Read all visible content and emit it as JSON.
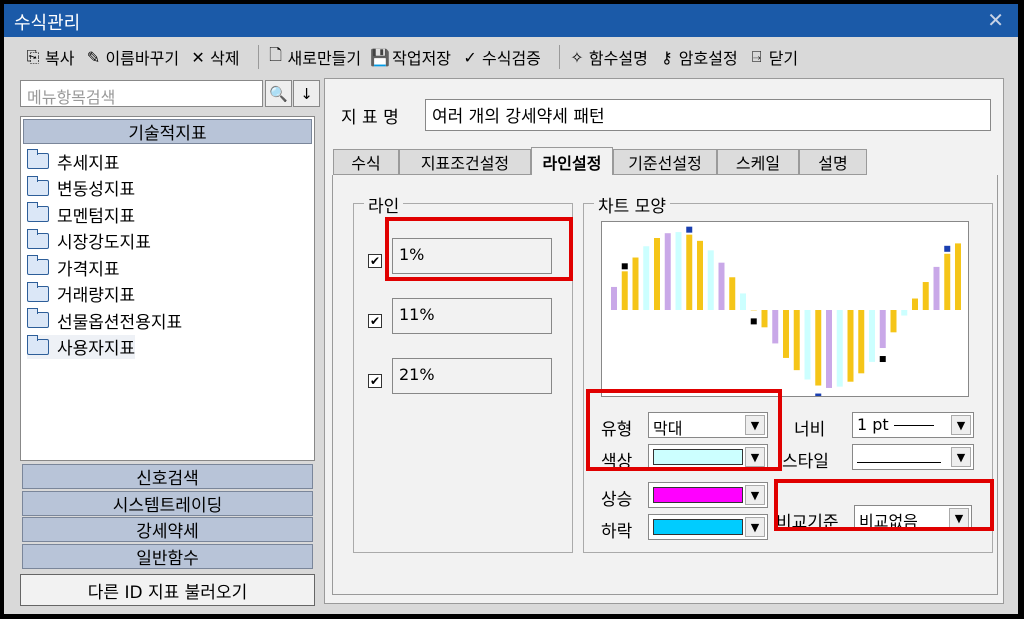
{
  "window": {
    "title": "수식관리",
    "close": "✕"
  },
  "toolbar": [
    {
      "icon": "copy-icon",
      "glyph": "⎘",
      "label": "복사"
    },
    {
      "icon": "rename-icon",
      "glyph": "✎",
      "label": "이름바꾸기"
    },
    {
      "icon": "delete-icon",
      "glyph": "✕",
      "label": "삭제"
    },
    {
      "icon": "new-icon",
      "glyph": "🗋",
      "label": "새로만들기"
    },
    {
      "icon": "save-icon",
      "glyph": "💾",
      "label": "작업저장"
    },
    {
      "icon": "verify-icon",
      "glyph": "✓",
      "label": "수식검증"
    },
    {
      "icon": "function-help-icon",
      "glyph": "✧",
      "label": "함수설명"
    },
    {
      "icon": "key-icon",
      "glyph": "⚷",
      "label": "암호설정"
    },
    {
      "icon": "exit-icon",
      "glyph": "⍈",
      "label": "닫기"
    }
  ],
  "left": {
    "search_placeholder": "메뉴항목검색",
    "search_icon": "🔍",
    "down_icon": "↓",
    "header": "기술적지표",
    "tree": [
      "추세지표",
      "변동성지표",
      "모멘텀지표",
      "시장강도지표",
      "가격지표",
      "거래량지표",
      "선물옵션전용지표",
      "사용자지표"
    ],
    "sections": [
      "신호검색",
      "시스템트레이딩",
      "강세약세",
      "일반함수"
    ],
    "load_button": "다른 ID 지표 불러오기"
  },
  "right": {
    "name_label": "지 표 명",
    "name_value": "여러 개의 강세약세 패턴",
    "tabs": [
      "수식",
      "지표조건설정",
      "라인설정",
      "기준선설정",
      "스케일",
      "설명"
    ],
    "active_tab": "라인설정",
    "line_group": "라인",
    "lines": [
      {
        "checked": true,
        "value": "1%"
      },
      {
        "checked": true,
        "value": "11%"
      },
      {
        "checked": true,
        "value": "21%"
      }
    ],
    "chart_group": "차트 모양",
    "type_label": "유형",
    "type_value": "막대",
    "color_label": "색상",
    "color_value": "#ccffff",
    "up_label": "상승",
    "up_value": "#ff00ff",
    "down_label": "하락",
    "down_value": "#00ccff",
    "width_label": "너비",
    "width_value": "1 pt",
    "style_label": "스타일",
    "compare_label": "비교기준",
    "compare_value": "비교없음"
  },
  "colors": {
    "titlebar": "#1b5aa8",
    "highlight": "#e00000",
    "bar": "#f5c518",
    "cyan": "#ccffff",
    "purple": "#c9a8e8"
  }
}
